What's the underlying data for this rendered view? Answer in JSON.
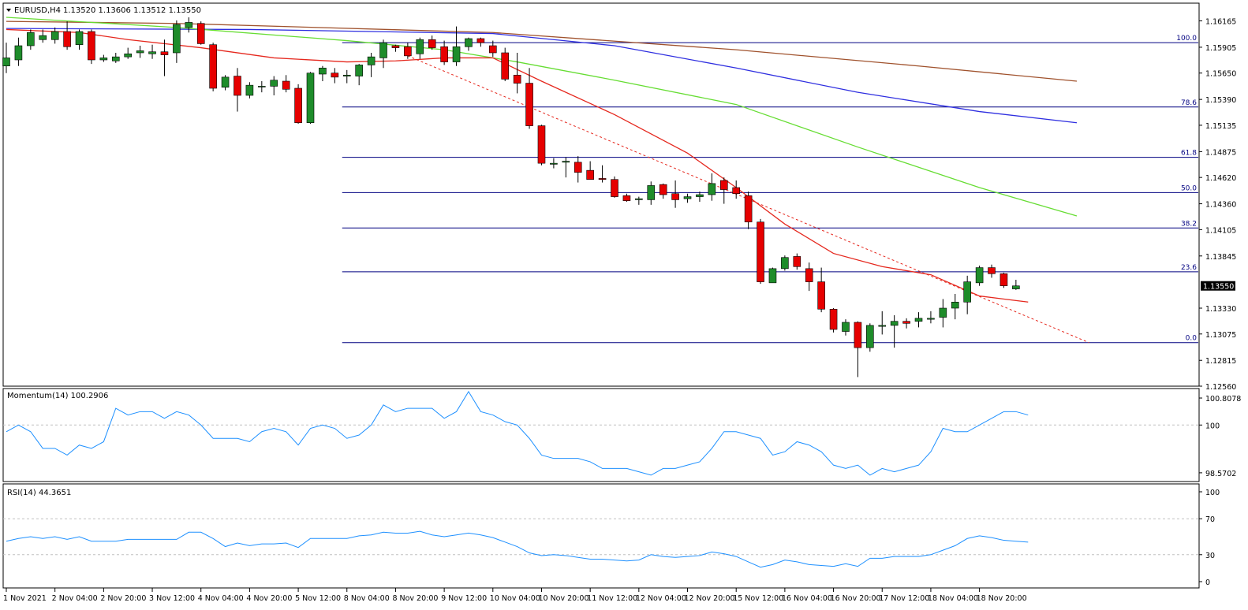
{
  "header": {
    "symbol_label": "EURUSD,H4",
    "ohlc_label": "1.13520 1.13606 1.13512 1.13550"
  },
  "colors": {
    "background": "#ffffff",
    "grid": "#c0c0c0",
    "bull_candle": "#1e8c2a",
    "bear_candle": "#e60000",
    "candle_wick": "#000000",
    "fib_line": "#000080",
    "ma_fast": "#e5281e",
    "ma_green": "#66dd33",
    "ma_blue": "#2f2fe0",
    "ma_brown": "#a0522d",
    "trendline": "#e5281e",
    "indicator_line": "#1e90ff"
  },
  "chart_data": [
    {
      "type": "candlestick",
      "name": "EURUSD,H4",
      "ylim": [
        1.1256,
        1.1634
      ],
      "y_ticks": [
        1.16165,
        1.15905,
        1.1565,
        1.1539,
        1.15135,
        1.14875,
        1.1462,
        1.1436,
        1.14105,
        1.13845,
        1.1333,
        1.13075,
        1.12815,
        1.1256
      ],
      "y_tick_labels": [
        "1.16165",
        "1.15905",
        "1.15650",
        "1.15390",
        "1.15135",
        "1.14875",
        "1.14620",
        "1.14360",
        "1.14105",
        "1.13845",
        "1.13330",
        "1.13075",
        "1.12815",
        "1.12560"
      ],
      "current_price_label": "1.13550",
      "current_price": 1.1355,
      "x_labels": [
        "1 Nov 2021",
        "2 Nov 04:00",
        "2 Nov 20:00",
        "3 Nov 12:00",
        "4 Nov 04:00",
        "4 Nov 20:00",
        "5 Nov 12:00",
        "8 Nov 04:00",
        "8 Nov 20:00",
        "9 Nov 12:00",
        "10 Nov 04:00",
        "10 Nov 20:00",
        "11 Nov 12:00",
        "12 Nov 04:00",
        "12 Nov 20:00",
        "15 Nov 12:00",
        "16 Nov 04:00",
        "16 Nov 20:00",
        "17 Nov 12:00",
        "18 Nov 04:00",
        "18 Nov 20:00"
      ],
      "x_label_bar_index": [
        0,
        4,
        8,
        12,
        16,
        20,
        24,
        28,
        32,
        36,
        40,
        44,
        48,
        52,
        56,
        60,
        64,
        68,
        72,
        76,
        80
      ],
      "candles": [
        {
          "o": 1.1572,
          "h": 1.1595,
          "l": 1.1565,
          "c": 1.158
        },
        {
          "o": 1.1578,
          "h": 1.16,
          "l": 1.1572,
          "c": 1.1592
        },
        {
          "o": 1.1592,
          "h": 1.1608,
          "l": 1.1588,
          "c": 1.1605
        },
        {
          "o": 1.1598,
          "h": 1.1608,
          "l": 1.1595,
          "c": 1.1602
        },
        {
          "o": 1.1598,
          "h": 1.161,
          "l": 1.1594,
          "c": 1.1606
        },
        {
          "o": 1.1606,
          "h": 1.1616,
          "l": 1.1588,
          "c": 1.1591
        },
        {
          "o": 1.1593,
          "h": 1.1608,
          "l": 1.1588,
          "c": 1.1606
        },
        {
          "o": 1.1606,
          "h": 1.1608,
          "l": 1.1574,
          "c": 1.1578
        },
        {
          "o": 1.1578,
          "h": 1.1583,
          "l": 1.1576,
          "c": 1.158
        },
        {
          "o": 1.1577,
          "h": 1.1585,
          "l": 1.1575,
          "c": 1.1581
        },
        {
          "o": 1.1581,
          "h": 1.159,
          "l": 1.1579,
          "c": 1.1584
        },
        {
          "o": 1.1585,
          "h": 1.1592,
          "l": 1.158,
          "c": 1.1587
        },
        {
          "o": 1.1584,
          "h": 1.1593,
          "l": 1.1579,
          "c": 1.1586
        },
        {
          "o": 1.1586,
          "h": 1.1598,
          "l": 1.1562,
          "c": 1.1583
        },
        {
          "o": 1.1585,
          "h": 1.1617,
          "l": 1.1575,
          "c": 1.1613
        },
        {
          "o": 1.161,
          "h": 1.162,
          "l": 1.1605,
          "c": 1.1615
        },
        {
          "o": 1.1614,
          "h": 1.1616,
          "l": 1.1593,
          "c": 1.1594
        },
        {
          "o": 1.1593,
          "h": 1.1595,
          "l": 1.1547,
          "c": 1.155
        },
        {
          "o": 1.1551,
          "h": 1.1563,
          "l": 1.1548,
          "c": 1.1561
        },
        {
          "o": 1.1562,
          "h": 1.157,
          "l": 1.1527,
          "c": 1.1543
        },
        {
          "o": 1.1543,
          "h": 1.1556,
          "l": 1.154,
          "c": 1.1553
        },
        {
          "o": 1.1552,
          "h": 1.1557,
          "l": 1.1546,
          "c": 1.1552
        },
        {
          "o": 1.1552,
          "h": 1.1562,
          "l": 1.1543,
          "c": 1.1558
        },
        {
          "o": 1.1557,
          "h": 1.1563,
          "l": 1.1546,
          "c": 1.1549
        },
        {
          "o": 1.155,
          "h": 1.1554,
          "l": 1.1515,
          "c": 1.1516
        },
        {
          "o": 1.1516,
          "h": 1.1566,
          "l": 1.1515,
          "c": 1.1565
        },
        {
          "o": 1.1564,
          "h": 1.1572,
          "l": 1.1557,
          "c": 1.157
        },
        {
          "o": 1.1565,
          "h": 1.157,
          "l": 1.1555,
          "c": 1.1561
        },
        {
          "o": 1.1562,
          "h": 1.1568,
          "l": 1.1555,
          "c": 1.1563
        },
        {
          "o": 1.1562,
          "h": 1.1574,
          "l": 1.1553,
          "c": 1.1573
        },
        {
          "o": 1.1573,
          "h": 1.1585,
          "l": 1.1561,
          "c": 1.1581
        },
        {
          "o": 1.158,
          "h": 1.1598,
          "l": 1.157,
          "c": 1.1595
        },
        {
          "o": 1.1592,
          "h": 1.1593,
          "l": 1.1586,
          "c": 1.159
        },
        {
          "o": 1.1591,
          "h": 1.1595,
          "l": 1.1579,
          "c": 1.1582
        },
        {
          "o": 1.1584,
          "h": 1.16,
          "l": 1.1579,
          "c": 1.1598
        },
        {
          "o": 1.1598,
          "h": 1.1602,
          "l": 1.1588,
          "c": 1.159
        },
        {
          "o": 1.1591,
          "h": 1.1597,
          "l": 1.1573,
          "c": 1.1576
        },
        {
          "o": 1.1576,
          "h": 1.1611,
          "l": 1.1572,
          "c": 1.1591
        },
        {
          "o": 1.1591,
          "h": 1.16,
          "l": 1.1587,
          "c": 1.1599
        },
        {
          "o": 1.1599,
          "h": 1.16,
          "l": 1.1591,
          "c": 1.1595
        },
        {
          "o": 1.1592,
          "h": 1.1597,
          "l": 1.1581,
          "c": 1.1585
        },
        {
          "o": 1.1585,
          "h": 1.159,
          "l": 1.1557,
          "c": 1.1559
        },
        {
          "o": 1.1563,
          "h": 1.1585,
          "l": 1.1545,
          "c": 1.1555
        },
        {
          "o": 1.1555,
          "h": 1.157,
          "l": 1.151,
          "c": 1.1513
        },
        {
          "o": 1.1513,
          "h": 1.1514,
          "l": 1.1474,
          "c": 1.1476
        },
        {
          "o": 1.1475,
          "h": 1.1481,
          "l": 1.1471,
          "c": 1.1476
        },
        {
          "o": 1.1477,
          "h": 1.1482,
          "l": 1.1462,
          "c": 1.1478
        },
        {
          "o": 1.1477,
          "h": 1.1483,
          "l": 1.1457,
          "c": 1.1467
        },
        {
          "o": 1.1469,
          "h": 1.1478,
          "l": 1.1461,
          "c": 1.146
        },
        {
          "o": 1.1461,
          "h": 1.1474,
          "l": 1.1457,
          "c": 1.146
        },
        {
          "o": 1.146,
          "h": 1.1463,
          "l": 1.1442,
          "c": 1.1443
        },
        {
          "o": 1.1444,
          "h": 1.1446,
          "l": 1.1438,
          "c": 1.1439
        },
        {
          "o": 1.144,
          "h": 1.1443,
          "l": 1.1435,
          "c": 1.1441
        },
        {
          "o": 1.144,
          "h": 1.1458,
          "l": 1.1435,
          "c": 1.1454
        },
        {
          "o": 1.1455,
          "h": 1.1456,
          "l": 1.1441,
          "c": 1.1445
        },
        {
          "o": 1.1446,
          "h": 1.1459,
          "l": 1.1432,
          "c": 1.144
        },
        {
          "o": 1.1441,
          "h": 1.1446,
          "l": 1.1437,
          "c": 1.1443
        },
        {
          "o": 1.1443,
          "h": 1.1448,
          "l": 1.1438,
          "c": 1.1445
        },
        {
          "o": 1.1445,
          "h": 1.1466,
          "l": 1.1439,
          "c": 1.1456
        },
        {
          "o": 1.1459,
          "h": 1.1462,
          "l": 1.1436,
          "c": 1.145
        },
        {
          "o": 1.1452,
          "h": 1.1459,
          "l": 1.1441,
          "c": 1.1446
        },
        {
          "o": 1.1444,
          "h": 1.1448,
          "l": 1.1411,
          "c": 1.1418
        },
        {
          "o": 1.1418,
          "h": 1.1421,
          "l": 1.1357,
          "c": 1.1359
        },
        {
          "o": 1.1358,
          "h": 1.1373,
          "l": 1.1358,
          "c": 1.1372
        },
        {
          "o": 1.1372,
          "h": 1.1385,
          "l": 1.137,
          "c": 1.1383
        },
        {
          "o": 1.1384,
          "h": 1.1387,
          "l": 1.1371,
          "c": 1.1374
        },
        {
          "o": 1.1372,
          "h": 1.1378,
          "l": 1.135,
          "c": 1.1359
        },
        {
          "o": 1.1359,
          "h": 1.1373,
          "l": 1.1329,
          "c": 1.1332
        },
        {
          "o": 1.1332,
          "h": 1.1333,
          "l": 1.1309,
          "c": 1.1312
        },
        {
          "o": 1.131,
          "h": 1.1322,
          "l": 1.1306,
          "c": 1.1319
        },
        {
          "o": 1.1319,
          "h": 1.132,
          "l": 1.1265,
          "c": 1.1294
        },
        {
          "o": 1.1294,
          "h": 1.1318,
          "l": 1.129,
          "c": 1.1316
        },
        {
          "o": 1.1315,
          "h": 1.133,
          "l": 1.1307,
          "c": 1.1316
        },
        {
          "o": 1.1316,
          "h": 1.1326,
          "l": 1.1294,
          "c": 1.132
        },
        {
          "o": 1.132,
          "h": 1.1323,
          "l": 1.1313,
          "c": 1.1318
        },
        {
          "o": 1.132,
          "h": 1.1329,
          "l": 1.1314,
          "c": 1.1323
        },
        {
          "o": 1.1322,
          "h": 1.133,
          "l": 1.1318,
          "c": 1.1323
        },
        {
          "o": 1.1324,
          "h": 1.1342,
          "l": 1.1314,
          "c": 1.1333
        },
        {
          "o": 1.1333,
          "h": 1.1347,
          "l": 1.1322,
          "c": 1.1339
        },
        {
          "o": 1.1339,
          "h": 1.1365,
          "l": 1.1327,
          "c": 1.1359
        },
        {
          "o": 1.1358,
          "h": 1.1375,
          "l": 1.1355,
          "c": 1.1373
        },
        {
          "o": 1.1373,
          "h": 1.1376,
          "l": 1.1363,
          "c": 1.1367
        },
        {
          "o": 1.1367,
          "h": 1.1368,
          "l": 1.1353,
          "c": 1.1355
        },
        {
          "o": 1.1352,
          "h": 1.1361,
          "l": 1.1351,
          "c": 1.1355
        }
      ],
      "fibonacci": {
        "high": 1.1595,
        "low": 1.1299,
        "levels": [
          {
            "label": "100.0",
            "value": 1.1595
          },
          {
            "label": "78.6",
            "value": 1.15315
          },
          {
            "label": "61.8",
            "value": 1.14818
          },
          {
            "label": "50.0",
            "value": 1.1447
          },
          {
            "label": "38.2",
            "value": 1.14121
          },
          {
            "label": "23.6",
            "value": 1.13689
          },
          {
            "label": "0.0",
            "value": 1.1299
          }
        ],
        "start_bar": 28,
        "end_bar": 88
      },
      "trendline": {
        "start_bar": 33,
        "start_price": 1.1582,
        "end_bar": 89,
        "end_price": 1.1299,
        "style": "dashed"
      },
      "moving_averages": [
        {
          "color_key": "ma_brown",
          "start_bar": 0,
          "points": [
            [
              0,
              1.1616
            ],
            [
              14,
              1.1614
            ],
            [
              40,
              1.1605
            ],
            [
              60,
              1.1588
            ],
            [
              75,
              1.1572
            ],
            [
              88,
              1.1557
            ]
          ]
        },
        {
          "color_key": "ma_blue",
          "start_bar": 0,
          "points": [
            [
              0,
              1.1609
            ],
            [
              20,
              1.1608
            ],
            [
              40,
              1.1604
            ],
            [
              50,
              1.1592
            ],
            [
              60,
              1.157
            ],
            [
              70,
              1.1546
            ],
            [
              80,
              1.1527
            ],
            [
              88,
              1.1516
            ]
          ]
        },
        {
          "color_key": "ma_green",
          "start_bar": 0,
          "points": [
            [
              0,
              1.162
            ],
            [
              14,
              1.161
            ],
            [
              28,
              1.1597
            ],
            [
              36,
              1.1588
            ],
            [
              42,
              1.1576
            ],
            [
              50,
              1.1558
            ],
            [
              60,
              1.1534
            ],
            [
              70,
              1.1492
            ],
            [
              80,
              1.1452
            ],
            [
              88,
              1.1424
            ]
          ]
        },
        {
          "color_key": "ma_fast",
          "start_bar": 0,
          "points": [
            [
              0,
              1.1608
            ],
            [
              6,
              1.1605
            ],
            [
              10,
              1.1598
            ],
            [
              16,
              1.159
            ],
            [
              22,
              1.158
            ],
            [
              28,
              1.1576
            ],
            [
              32,
              1.1577
            ],
            [
              36,
              1.158
            ],
            [
              40,
              1.158
            ],
            [
              44,
              1.1557
            ],
            [
              50,
              1.1524
            ],
            [
              56,
              1.1486
            ],
            [
              60,
              1.1452
            ],
            [
              64,
              1.1416
            ],
            [
              68,
              1.1387
            ],
            [
              72,
              1.1374
            ],
            [
              76,
              1.1366
            ],
            [
              80,
              1.1345
            ],
            [
              84,
              1.1339
            ]
          ]
        }
      ]
    },
    {
      "type": "line",
      "name": "Momentum(14)",
      "label": "Momentum(14) 100.2906",
      "ylim": [
        98.45,
        100.95
      ],
      "y_tick_labels": [
        "100.8078",
        "100",
        "98.5702"
      ],
      "y_ticks": [
        100.8078,
        100.0,
        98.5702
      ],
      "reference_line": 100.0,
      "values": [
        99.8,
        100.0,
        99.8,
        99.3,
        99.3,
        99.1,
        99.4,
        99.3,
        99.5,
        100.5,
        100.3,
        100.4,
        100.4,
        100.2,
        100.4,
        100.3,
        100.0,
        99.6,
        99.6,
        99.6,
        99.5,
        99.8,
        99.9,
        99.8,
        99.4,
        99.9,
        100.0,
        99.9,
        99.6,
        99.7,
        100.0,
        100.6,
        100.4,
        100.5,
        100.5,
        100.5,
        100.2,
        100.4,
        101.0,
        100.4,
        100.3,
        100.1,
        100.0,
        99.6,
        99.1,
        99.0,
        99.0,
        99.0,
        98.9,
        98.7,
        98.7,
        98.7,
        98.6,
        98.5,
        98.7,
        98.7,
        98.8,
        98.9,
        99.3,
        99.8,
        99.8,
        99.7,
        99.6,
        99.1,
        99.2,
        99.5,
        99.4,
        99.2,
        98.8,
        98.7,
        98.8,
        98.5,
        98.7,
        98.6,
        98.7,
        98.8,
        99.2,
        99.9,
        99.8,
        99.8,
        100.0,
        100.2,
        100.4,
        100.4,
        100.3
      ]
    },
    {
      "type": "line",
      "name": "RSI(14)",
      "label": "RSI(14) 44.3651",
      "ylim": [
        0,
        100
      ],
      "y_tick_labels": [
        "100",
        "70",
        "30",
        "0"
      ],
      "y_ticks": [
        100,
        70,
        30,
        0
      ],
      "reference_lines": [
        70,
        30
      ],
      "values": [
        45,
        48,
        50,
        48,
        50,
        47,
        50,
        45,
        45,
        45,
        47,
        47,
        47,
        47,
        47,
        55,
        55,
        48,
        39,
        43,
        40,
        42,
        42,
        43,
        38,
        48,
        48,
        48,
        48,
        51,
        52,
        55,
        54,
        54,
        56,
        52,
        50,
        52,
        54,
        52,
        49,
        44,
        39,
        32,
        29,
        30,
        29,
        27,
        25,
        25,
        24,
        23,
        24,
        30,
        28,
        27,
        28,
        29,
        33,
        31,
        28,
        22,
        16,
        19,
        24,
        22,
        19,
        18,
        17,
        20,
        17,
        26,
        26,
        28,
        28,
        28,
        30,
        35,
        40,
        48,
        51,
        49,
        46,
        45,
        44
      ]
    }
  ]
}
